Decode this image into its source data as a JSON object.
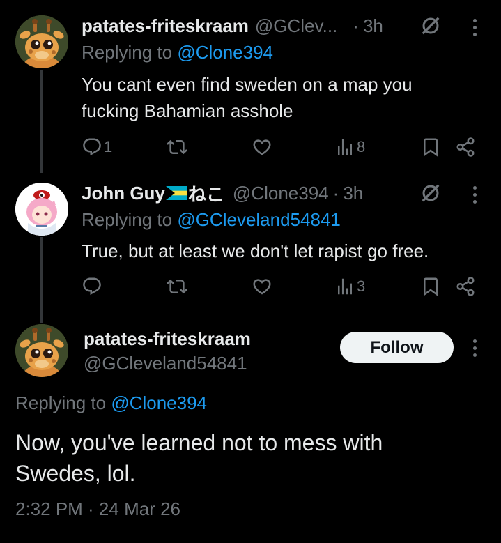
{
  "tweet1": {
    "display_name": "patates-friteskraam",
    "handle": "@GClev...",
    "separator": "·",
    "time": "3h",
    "replying_prefix": "Replying to",
    "replying_to": "@Clone394",
    "text": "You cant even find sweden on a map you fucking Bahamian asshole",
    "replies": "1",
    "retweets": "",
    "likes": "",
    "views": "8"
  },
  "tweet2": {
    "display_name": "John Guy",
    "name_suffix": "ねこ",
    "flag": "bahamas-flag",
    "handle": "@Clone394",
    "separator": "·",
    "time": "3h",
    "replying_prefix": "Replying to",
    "replying_to": "@GCleveland54841",
    "text": "True, but at least we don't let rapist go free.",
    "replies": "",
    "retweets": "",
    "likes": "",
    "views": "3"
  },
  "main_tweet": {
    "display_name": "patates-friteskraam",
    "handle": "@GCleveland54841",
    "follow_label": "Follow",
    "replying_prefix": "Replying to",
    "replying_to": "@Clone394",
    "text_line1": "Now, you've learned not to mess with",
    "text_line2": "Swedes, lol.",
    "timestamp": "2:32 PM · 24 Mar 26"
  },
  "icons": [
    "reply-icon",
    "retweet-icon",
    "like-icon",
    "views-icon",
    "bookmark-icon",
    "share-icon",
    "grok-icon",
    "more-icon"
  ],
  "colors": {
    "background": "#000000",
    "text": "#e7e9ea",
    "muted": "#71767b",
    "link": "#1d9bf0",
    "thread_line": "#333639",
    "follow_bg": "#eff3f4"
  }
}
